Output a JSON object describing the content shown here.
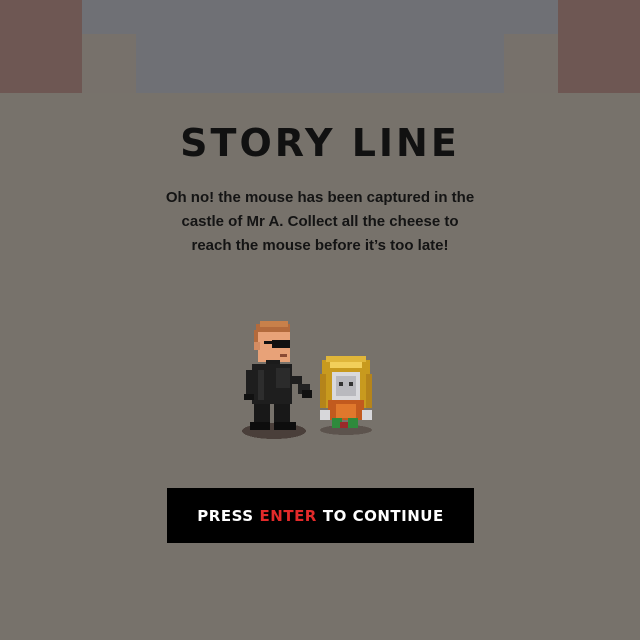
{
  "screen": {
    "title": "STORY LINE",
    "story_lines": [
      "Oh no! the mouse has been captured in the",
      "castle of Mr A. Collect all the cheese to",
      "reach the mouse before it’s too late!"
    ],
    "prompt": {
      "prefix": "PRESS",
      "key": "ENTER",
      "suffix": "TO CONTINUE"
    }
  },
  "colors": {
    "background": "#77726b",
    "wall_brown": "#6e5753",
    "wall_gray": "#6f7075",
    "button_bg": "#000000",
    "key_highlight": "#e32a2a"
  },
  "sprites": [
    "villain-mr-a-sprite",
    "captured-mouse-sprite"
  ]
}
